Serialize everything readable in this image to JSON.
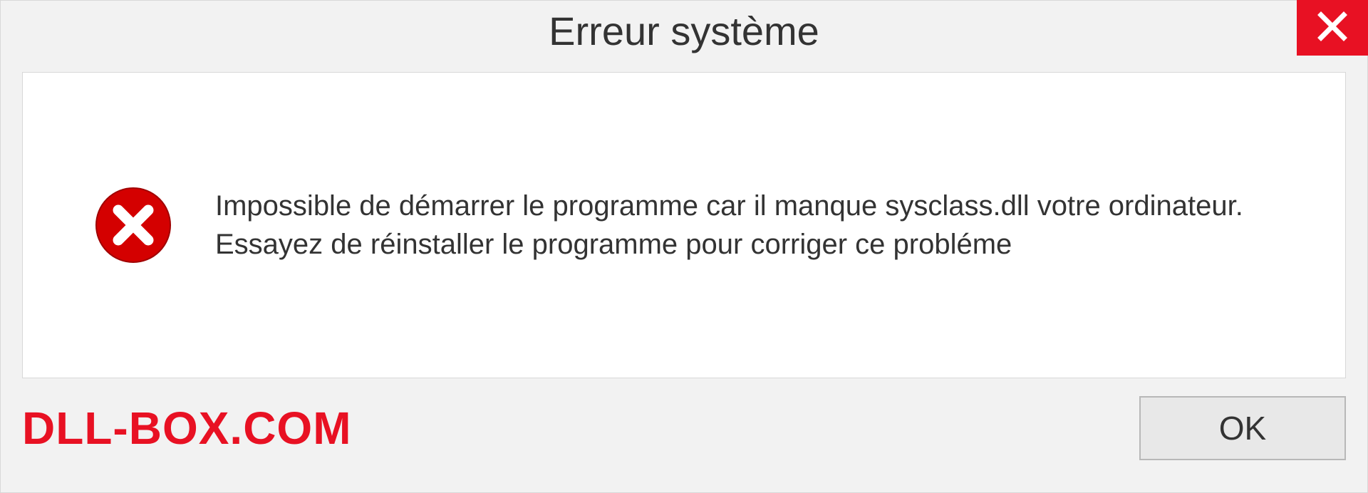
{
  "dialog": {
    "title": "Erreur système",
    "message": "Impossible de démarrer le programme car il manque sysclass.dll votre ordinateur. Essayez de réinstaller le programme pour corriger ce probléme",
    "ok_label": "OK"
  },
  "watermark": "DLL-BOX.COM",
  "colors": {
    "accent_red": "#e81123",
    "bg_gray": "#f2f2f2",
    "border_gray": "#d8d8d8"
  }
}
